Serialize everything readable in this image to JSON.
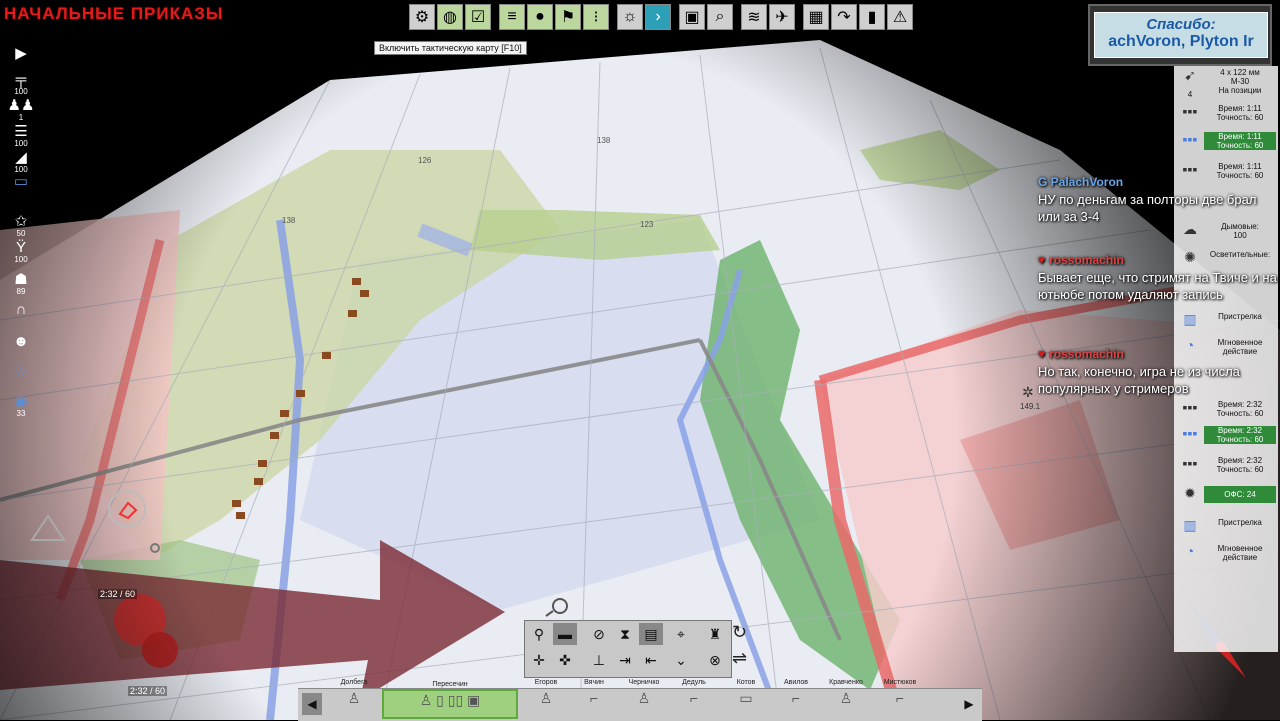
{
  "title": "НАЧАЛЬНЫЕ ПРИКАЗЫ",
  "toolbar": {
    "tooltip": "Включить тактическую карту [F10]",
    "buttons": [
      "gear-icon",
      "globe-icon",
      "check-icon",
      "list-icon",
      "circle-icon",
      "flag-icon",
      "dots-icon",
      "sun-icon",
      "next-icon",
      "film-icon",
      "search-icon",
      "radio-icon",
      "helicopter-icon",
      "chess-icon",
      "redo-icon",
      "stats-icon",
      "warning-icon"
    ]
  },
  "left_panel": [
    {
      "icon": "rifle-icon",
      "value": "100"
    },
    {
      "icon": "soldiers-icon",
      "value": "1"
    },
    {
      "icon": "ammo-icon",
      "value": "100"
    },
    {
      "icon": "fuel-icon",
      "value": "100"
    },
    {
      "icon": "vehicle-icon",
      "value": ""
    },
    {
      "icon": "star-icon",
      "value": "50"
    },
    {
      "icon": "badge-icon",
      "value": "100"
    },
    {
      "icon": "runner-icon",
      "value": "89"
    },
    {
      "icon": "lock-icon",
      "value": ""
    },
    {
      "icon": "head-icon",
      "value": ""
    },
    {
      "icon": "medal-icon",
      "value": ""
    },
    {
      "icon": "eye-icon",
      "value": "33"
    }
  ],
  "thanks": {
    "line1": "Спасибо:",
    "line2": "achVoron, Plyton Ir"
  },
  "right_panel": {
    "weapon": {
      "name": "4 x 122 мм",
      "model": "М-30",
      "count": "4",
      "status": "На позиции"
    },
    "fire_modes": [
      {
        "time": "Время: 1:11",
        "acc": "Точность: 60",
        "selected": false
      },
      {
        "time": "Время: 1:11",
        "acc": "Точность: 60",
        "selected": true
      },
      {
        "time": "Время: 1:11",
        "acc": "Точность: 60",
        "selected": false
      }
    ],
    "smoke": {
      "label": "Дымовые:",
      "value": "100"
    },
    "illum": {
      "label": "Осветительные:"
    },
    "ranging1": "Пристрелка",
    "instant1": "Мгновенное действие",
    "fire_modes2": [
      {
        "time": "Время: 2:32",
        "acc": "Точность: 60",
        "selected": false
      },
      {
        "time": "Время: 2:32",
        "acc": "Точность: 60",
        "selected": true
      },
      {
        "time": "Время: 2:32",
        "acc": "Точность: 60",
        "selected": false
      }
    ],
    "ofs": "ОФС: 24",
    "ranging2": "Пристрелка",
    "instant2": "Мгновенное действие"
  },
  "chat": [
    {
      "user": "PalachVoron",
      "text": "НУ по деньгам за полторы две брал или за 3-4"
    },
    {
      "user": "rossomachin",
      "text": "Бывает еще, что стримят на Твиче и на ютьюбе потом удаляют запись"
    },
    {
      "user": "rossomachin",
      "text": "Но так, конечно, игра не из числа популярных у стримеров"
    }
  ],
  "map": {
    "heights": [
      "126",
      "138",
      "138",
      "123",
      "149.1"
    ],
    "timer1": "2:32 / 60",
    "timer2": "2:32 / 60"
  },
  "dock": {
    "units": [
      "Долбега",
      "Пересечин",
      "",
      "",
      "",
      "Егоров",
      "Вячин",
      "Черничко",
      "Дедуль",
      "Котов",
      "Авилов",
      "Кравченко",
      "Мистюков"
    ]
  },
  "colors": {
    "accent_green": "#2f8a3a",
    "enemy_red": "#d63a3a",
    "title_red": "#e21b1b"
  }
}
